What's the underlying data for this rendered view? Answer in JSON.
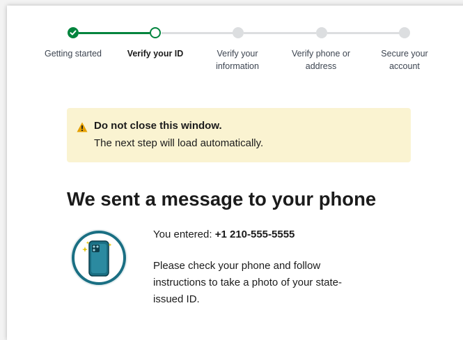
{
  "steps": [
    {
      "label": "Getting started",
      "state": "complete"
    },
    {
      "label": "Verify your ID",
      "state": "current"
    },
    {
      "label": "Verify your information",
      "state": "pending"
    },
    {
      "label": "Verify phone or address",
      "state": "pending"
    },
    {
      "label": "Secure your account",
      "state": "pending"
    }
  ],
  "alert": {
    "title": "Do not close this window.",
    "body": "The next step will load automatically.",
    "icon": "warning-icon"
  },
  "main": {
    "heading": "We sent a message to your phone",
    "entered_label": "You entered: ",
    "entered_phone": "+1 210-555-5555",
    "instructions": "Please check your phone and follow instructions to take a photo of your state-issued ID.",
    "illustration_icon": "phone-camera-icon"
  },
  "colors": {
    "progress_green": "#00843d",
    "pending_gray": "#dcdee0",
    "alert_bg": "#faf3d1",
    "warning_yellow": "#e5a000",
    "illustration_teal": "#1a6f83"
  }
}
